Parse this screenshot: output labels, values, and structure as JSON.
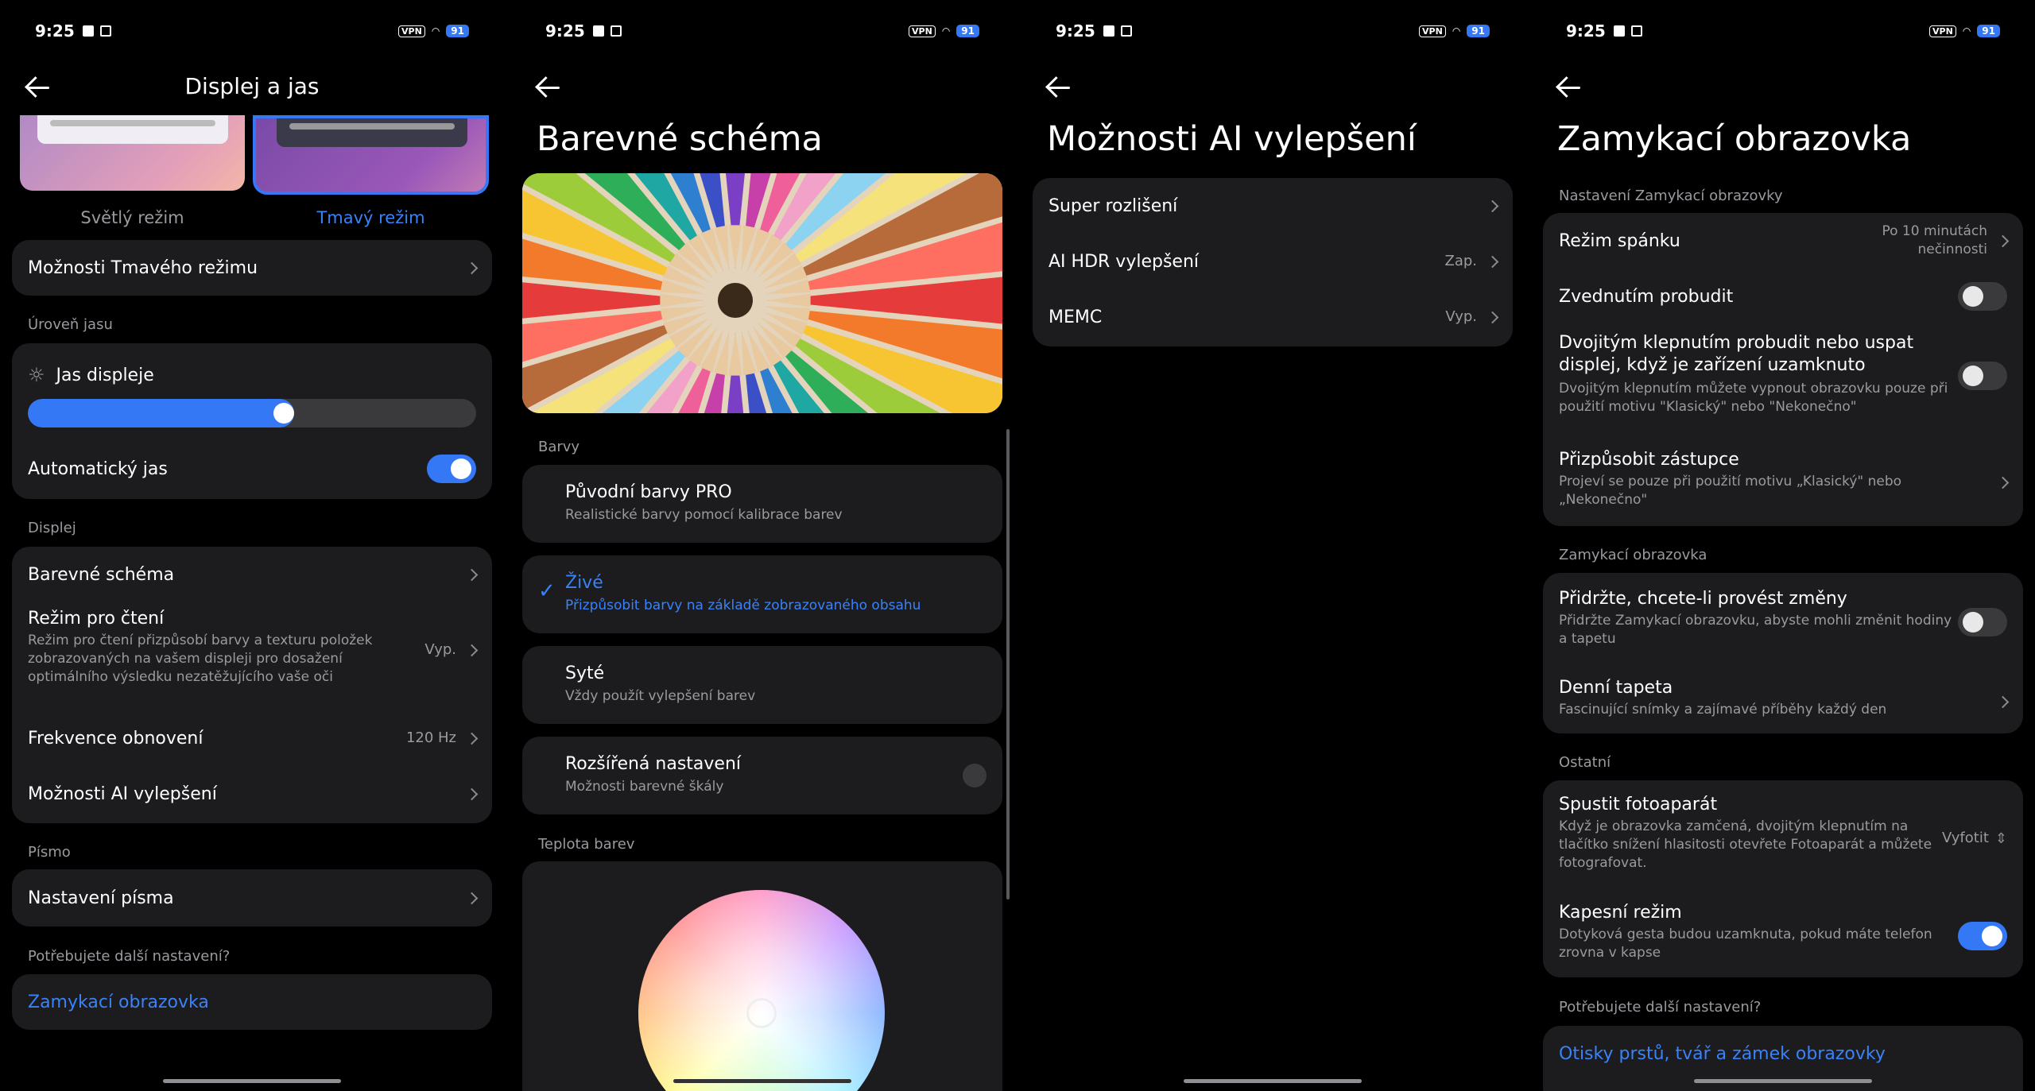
{
  "status": {
    "time": "9:25",
    "vpn": "VPN",
    "battery": "91"
  },
  "s1": {
    "title": "Displej a jas",
    "mode_light": "Světlý režim",
    "mode_dark": "Tmavý režim",
    "dark_options": "Možnosti Tmavého režimu",
    "sec_brightness": "Úroveň jasu",
    "brightness_label": "Jas displeje",
    "brightness_level": 0.55,
    "auto_brightness": "Automatický jas",
    "sec_display": "Displej",
    "color_scheme": "Barevné schéma",
    "reading_mode": "Režim pro čtení",
    "reading_mode_sub": "Režim pro čtení přizpůsobí barvy a texturu položek zobrazovaných na vašem displeji pro dosažení optimálního výsledku nezatěžujícího vaše oči",
    "reading_mode_val": "Vyp.",
    "refresh_rate": "Frekvence obnovení",
    "refresh_rate_val": "120 Hz",
    "ai_options": "Možnosti AI vylepšení",
    "sec_font": "Písmo",
    "font_settings": "Nastavení písma",
    "sec_more": "Potřebujete další nastavení?",
    "lock_screen_link": "Zamykací obrazovka"
  },
  "s2": {
    "title": "Barevné schéma",
    "sec_colors": "Barvy",
    "opt1": "Původní barvy PRO",
    "opt1_sub": "Realistické barvy pomocí kalibrace barev",
    "opt2": "Živé",
    "opt2_sub": "Přizpůsobit barvy na základě zobrazovaného obsahu",
    "opt3": "Syté",
    "opt3_sub": "Vždy použít vylepšení barev",
    "opt4": "Rozšířená nastavení",
    "opt4_sub": "Možnosti barevné škály",
    "sec_temp": "Teplota barev"
  },
  "s3": {
    "title": "Možnosti AI vylepšení",
    "super_res": "Super rozlišení",
    "ai_hdr": "AI HDR vylepšení",
    "ai_hdr_val": "Zap.",
    "memc": "MEMC",
    "memc_val": "Vyp."
  },
  "s4": {
    "title": "Zamykací obrazovka",
    "sec_settings": "Nastavení Zamykací obrazovky",
    "sleep": "Režim spánku",
    "sleep_val": "Po 10 minutách nečinnosti",
    "raise_wake": "Zvednutím probudit",
    "double_tap": "Dvojitým klepnutím probudit nebo uspat displej, když je zařízení uzamknuto",
    "double_tap_sub": "Dvojitým klepnutím můžete vypnout obrazovku pouze při použití motivu \"Klasický\" nebo \"Nekonečno\"",
    "customize_proxy": "Přizpůsobit zástupce",
    "customize_proxy_sub": "Projeví se pouze při použití motivu „Klasický\" nebo „Nekonečno\"",
    "sec_lock": "Zamykací obrazovka",
    "hold_change": "Přidržte, chcete-li provést změny",
    "hold_change_sub": "Přidržte Zamykací obrazovku, abyste mohli změnit hodiny a tapetu",
    "daily_wallpaper": "Denní tapeta",
    "daily_wallpaper_sub": "Fascinující snímky a zajímavé příběhy každý den",
    "sec_other": "Ostatní",
    "camera": "Spustit fotoaparát",
    "camera_sub": "Když je obrazovka zamčená, dvojitým klepnutím na tlačítko snížení hlasitosti otevřete Fotoaparát a můžete fotografovat.",
    "camera_val": "Vyfotit",
    "pocket": "Kapesní režim",
    "pocket_sub": "Dotyková gesta budou uzamknuta, pokud máte telefon zrovna v kapse",
    "sec_more": "Potřebujete další nastavení?",
    "fingerprint_link": "Otisky prstů, tvář a zámek obrazovky"
  }
}
